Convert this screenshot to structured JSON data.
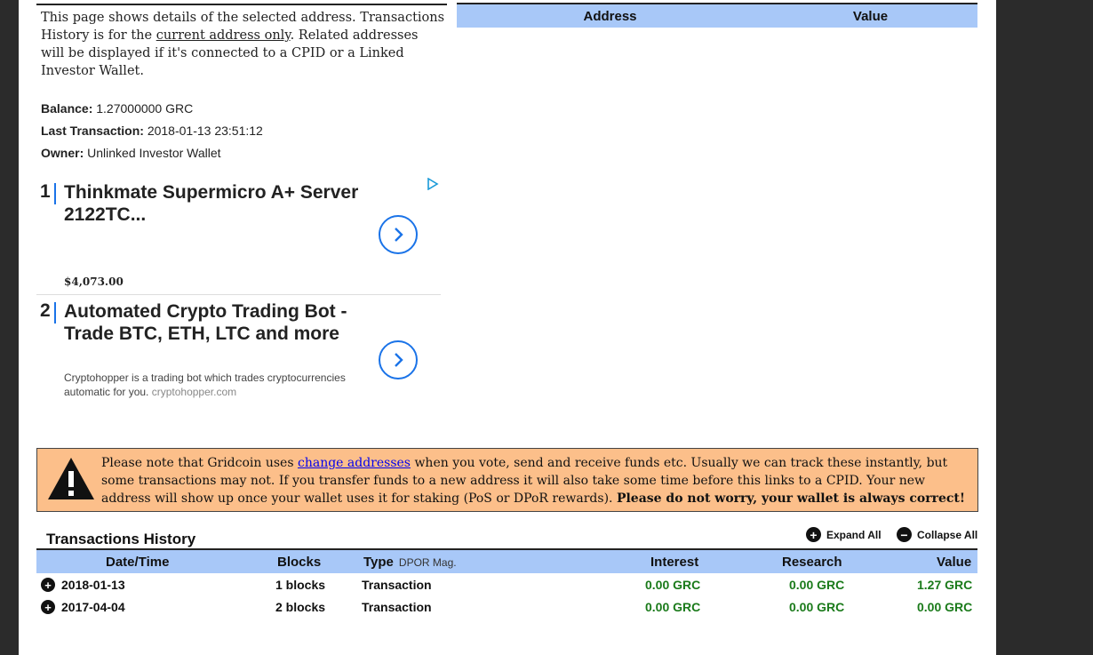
{
  "intro": {
    "text_before": "This page shows details of the selected address. Transactions History is for the ",
    "link_text": "current address only",
    "text_after": ". Related addresses will be displayed if it's connected to a CPID or a Linked Investor Wallet."
  },
  "details": {
    "balance_label": "Balance:",
    "balance_value": "1.27000000 GRC",
    "last_tx_label": "Last Transaction:",
    "last_tx_value": "2018-01-13 23:51:12",
    "owner_label": "Owner:",
    "owner_value": "Unlinked Investor Wallet"
  },
  "address_table": {
    "col_address": "Address",
    "col_value": "Value"
  },
  "ads": [
    {
      "num": "1",
      "title": "Thinkmate Supermicro A+ Server 2122TC...",
      "price": "$4,073.00"
    },
    {
      "num": "2",
      "title": "Automated Crypto Trading Bot - Trade BTC, ETH, LTC and more",
      "desc": "Cryptohopper is a trading bot which trades cryptocurrencies automatic for you.",
      "url": "cryptohopper.com"
    }
  ],
  "notice": {
    "before": "Please note that Gridcoin uses ",
    "link": "change addresses",
    "middle": " when you vote, send and receive funds etc. Usually we can track these instantly, but some transactions may not. If you transfer funds to a new address it will also take some time before this links to a CPID. Your new address will show up once your wallet uses it for staking (PoS or DPoR rewards). ",
    "bold": "Please do not worry, your wallet is always correct!"
  },
  "transactions": {
    "title": "Transactions History",
    "expand_all": "Expand All",
    "collapse_all": "Collapse All",
    "headers": {
      "datetime": "Date/Time",
      "blocks": "Blocks",
      "type": "Type",
      "type_sub": "DPOR Mag.",
      "interest": "Interest",
      "research": "Research",
      "value": "Value"
    },
    "rows": [
      {
        "date": "2018-01-13",
        "blocks": "1 blocks",
        "type": "Transaction",
        "interest": "0.00 GRC",
        "research": "0.00 GRC",
        "value": "1.27 GRC"
      },
      {
        "date": "2017-04-04",
        "blocks": "2 blocks",
        "type": "Transaction",
        "interest": "0.00 GRC",
        "research": "0.00 GRC",
        "value": "0.00 GRC"
      }
    ]
  },
  "colors": {
    "header_blue": "#a8c8f8",
    "notice_orange": "#fcbf8a",
    "value_green": "#1a7a1a",
    "ad_blue": "#1a73e8"
  }
}
